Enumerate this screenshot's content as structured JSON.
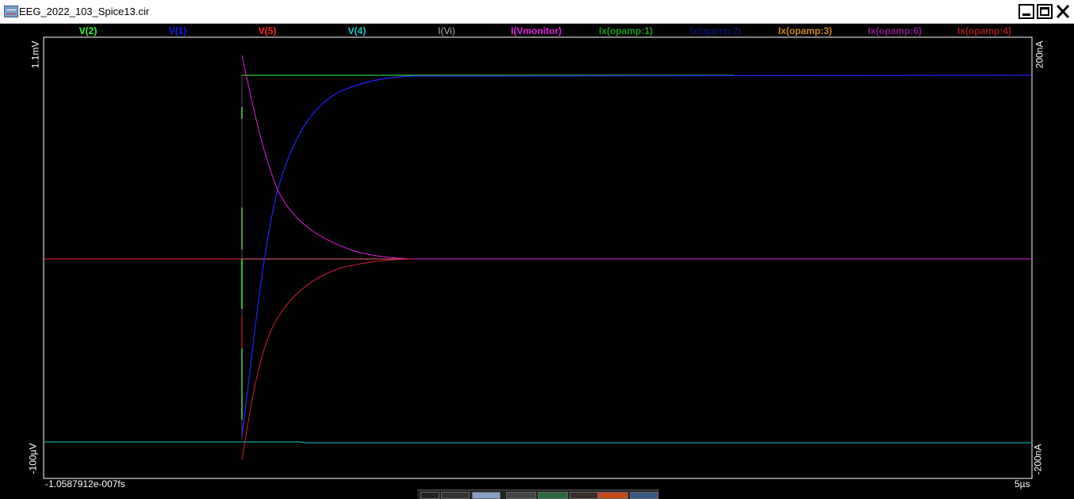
{
  "window": {
    "title": "EEG_2022_103_Spice13.cir"
  },
  "legend": [
    {
      "label": "V(2)",
      "color": "#33ff33"
    },
    {
      "label": "V(1)",
      "color": "#1a1aff"
    },
    {
      "label": "V(5)",
      "color": "#ff2020"
    },
    {
      "label": "V(4)",
      "color": "#1ec8c8"
    },
    {
      "label": "I(Vi)",
      "color": "#b0b0b0"
    },
    {
      "label": "I(Vmonitor)",
      "color": "#e020e0"
    },
    {
      "label": "Ix(opamp:1)",
      "color": "#1a9a1a"
    },
    {
      "label": "Ix(opamp:2)",
      "color": "#101090"
    },
    {
      "label": "Ix(opamp:3)",
      "color": "#c88a1a"
    },
    {
      "label": "Ix(opamp:6)",
      "color": "#8a1a8a"
    },
    {
      "label": "Ix(opamp:4)",
      "color": "#a01a1a"
    }
  ],
  "axes": {
    "left_top": "1.1mV",
    "left_bottom": "-100µV",
    "right_top": "200nA",
    "right_bottom": "-200nA",
    "x_start": "-1.0587912e-007fs",
    "x_end": "5µs"
  },
  "toolbar": {
    "buttons": [
      "select-tool",
      "cursor-tool",
      "window-tool",
      "export-tool",
      "filter-tool",
      "stop-tool",
      "chart-tool"
    ]
  }
}
